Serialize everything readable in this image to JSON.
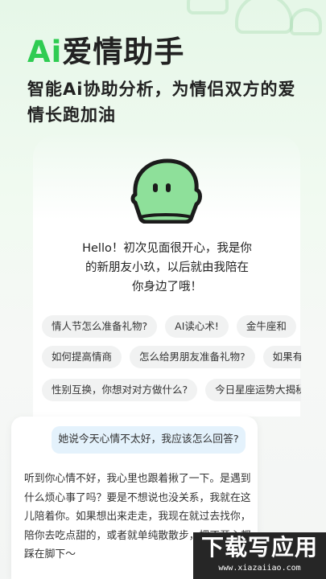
{
  "hero": {
    "title_ai": "Ai",
    "title_rest": "爱情助手",
    "subtitle": "智能Ai协助分析，为情侣双方的爱情长跑加油"
  },
  "greeting": "Hello！初次见面很开心，我是你的新朋友小玖，以后就由我陪在你身边了哦！",
  "suggestions": {
    "row1": [
      "情人节怎么准备礼物?",
      "AI读心术!",
      "金牛座和"
    ],
    "row2": [
      "如何提高情商",
      "怎么给男朋友准备礼物?",
      "如果有"
    ],
    "row3": [
      "性别互换，你想对对方做什么?",
      "今日星座运势大揭秘"
    ]
  },
  "chat": {
    "user_message": "她说今天心情不太好，我应该怎么回答?",
    "ai_reply": "听到你心情不好，我心里也跟着揪了一下。是遇到什么烦心事了吗？要是不想说也没关系，我就在这儿陪着你。如果想出来走走，我现在就过去找你，陪你去吃点甜的，或者就单纯散散步，把不开心都踩在脚下～"
  },
  "watermark": {
    "main": "下载写应用",
    "sub": "www.xiazaiiao.com"
  },
  "colors": {
    "accent_green": "#2fcc52",
    "mascot_green": "#8ee09a",
    "user_bubble": "#e4f2fc",
    "chip_bg": "#f1f2f2"
  }
}
